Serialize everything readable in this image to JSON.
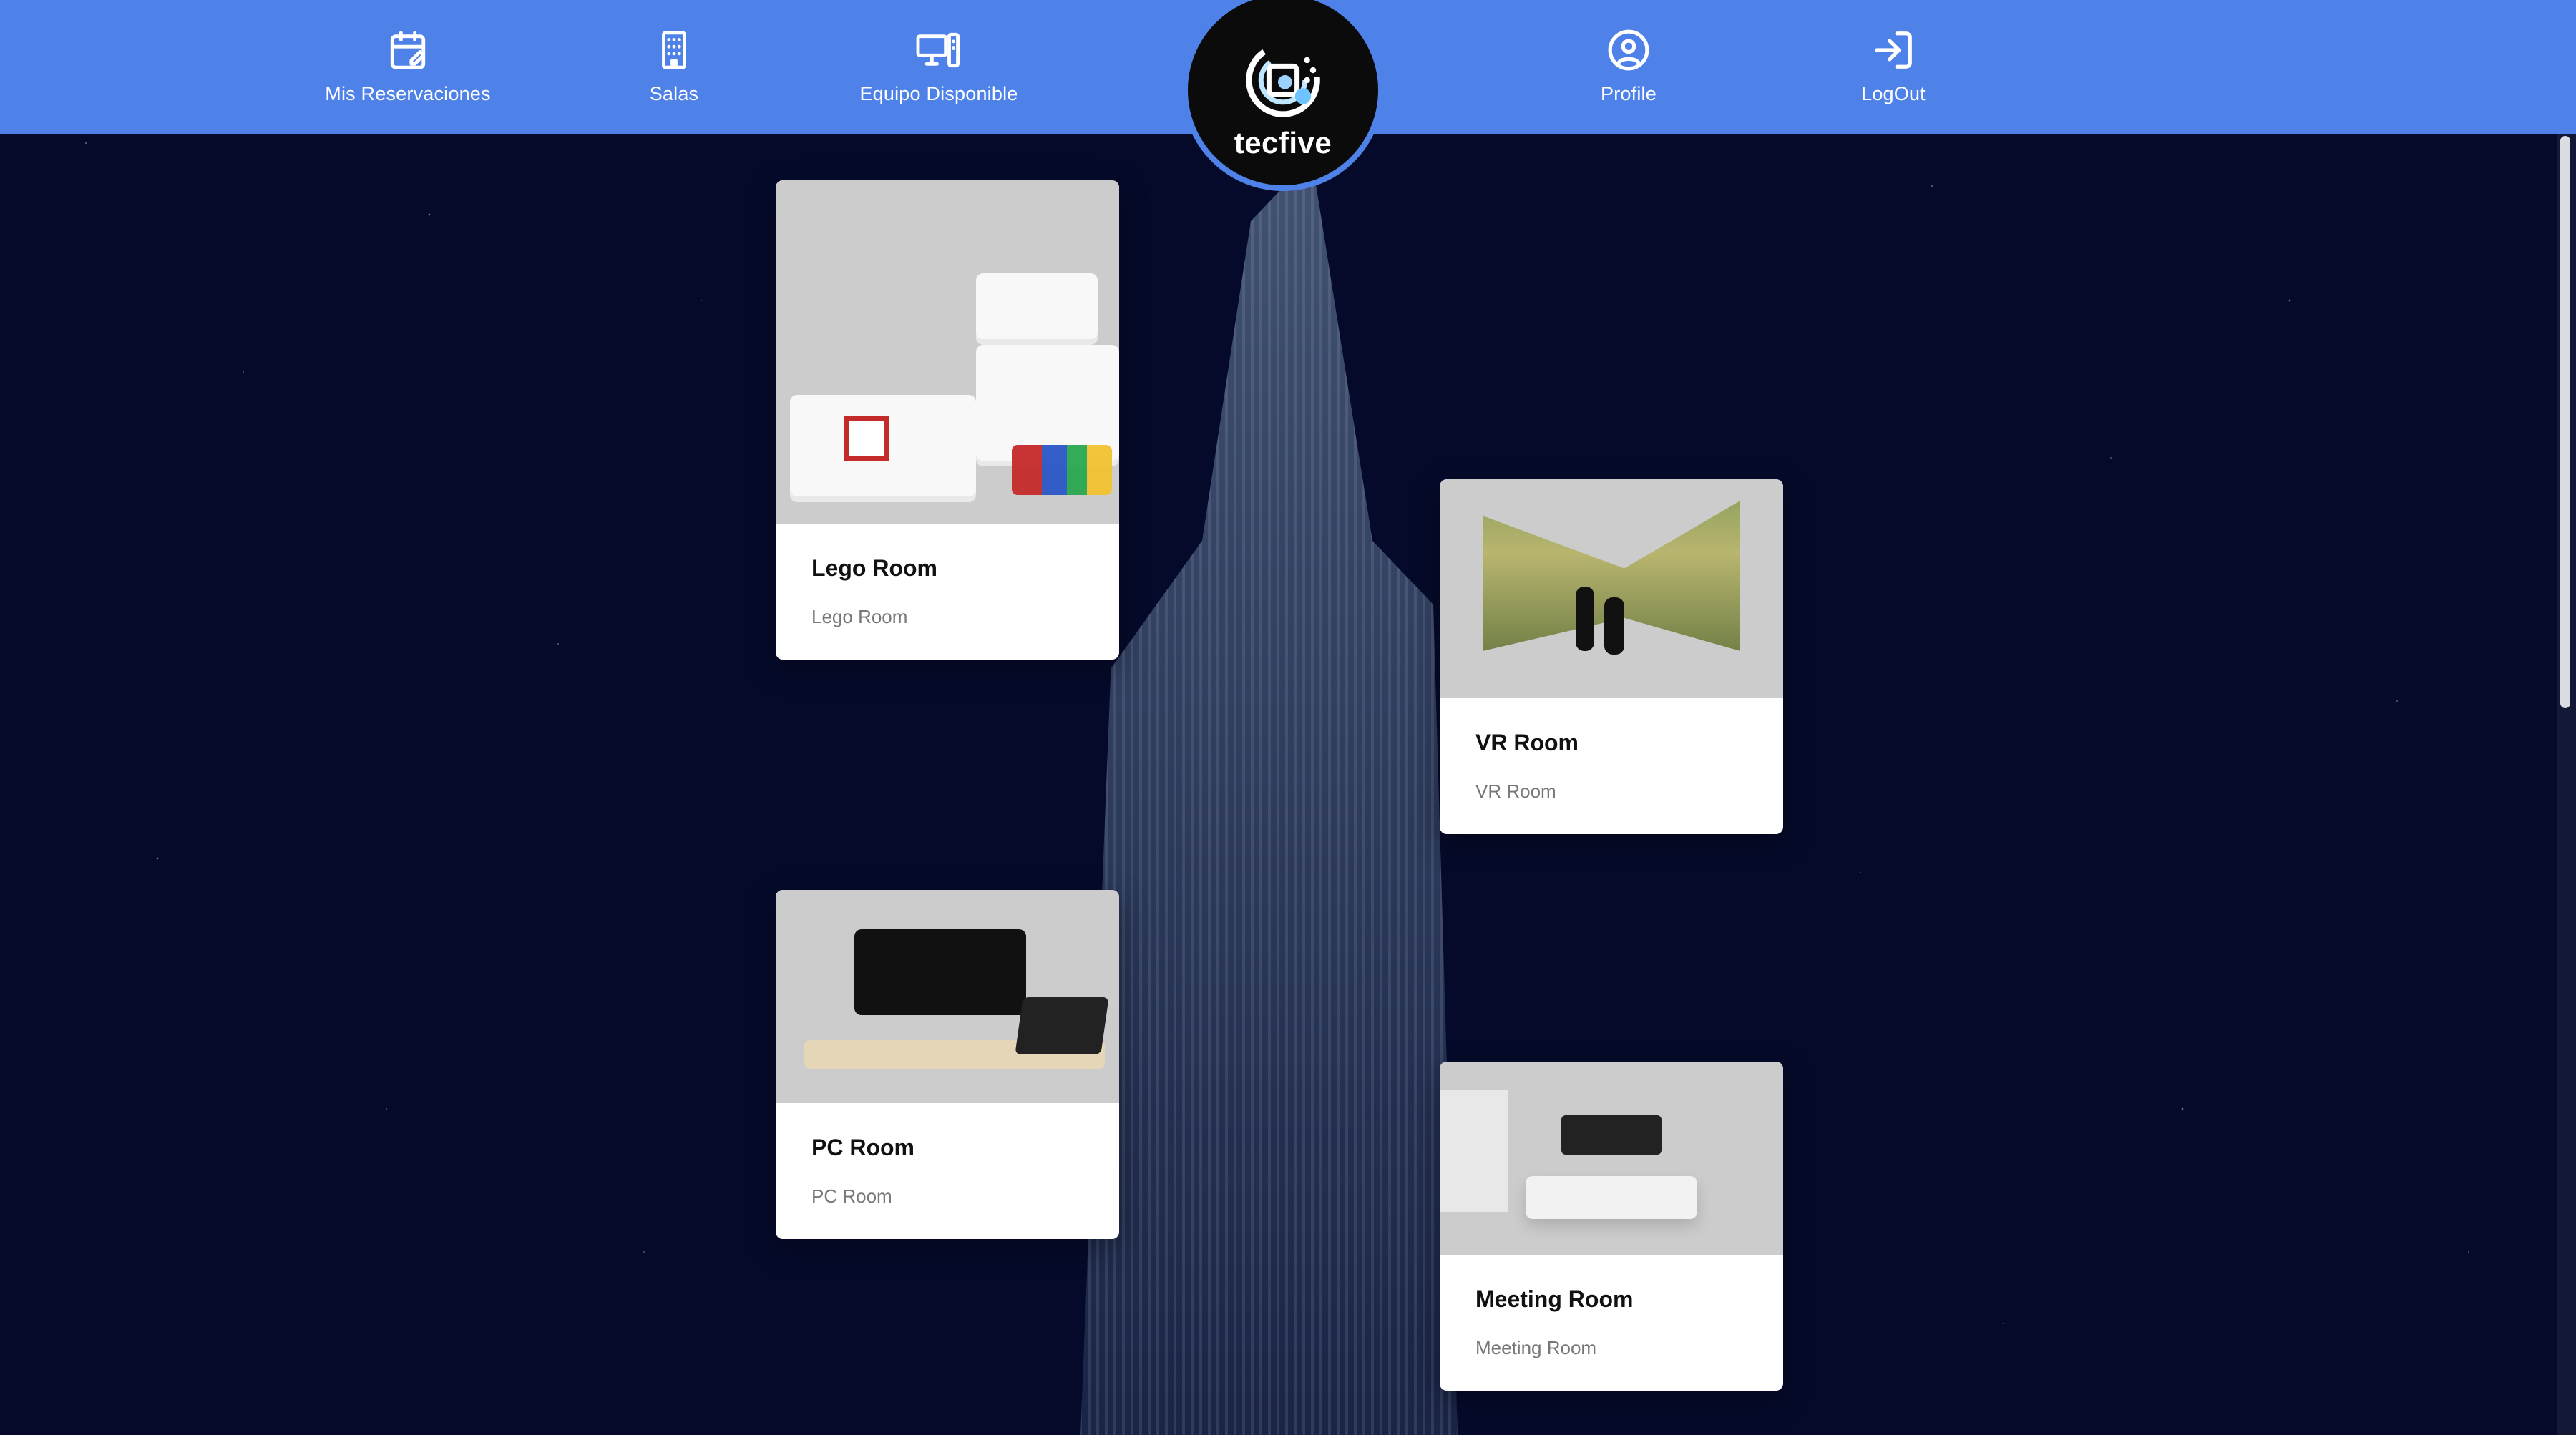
{
  "header": {
    "nav_items": [
      {
        "label": "Mis Reservaciones",
        "icon": "calendar-edit-icon"
      },
      {
        "label": "Salas",
        "icon": "building-icon"
      },
      {
        "label": "Equipo Disponible",
        "icon": "computer-equipment-icon"
      },
      {
        "label": "Profile",
        "icon": "user-circle-icon"
      },
      {
        "label": "LogOut",
        "icon": "logout-icon"
      }
    ],
    "logo_text": "tecfive",
    "accent_color": "#4f82e9"
  },
  "cards": [
    {
      "title": "Lego Room",
      "subtitle": "Lego Room"
    },
    {
      "title": "VR Room",
      "subtitle": "VR Room"
    },
    {
      "title": "PC Room",
      "subtitle": "PC Room"
    },
    {
      "title": "Meeting Room",
      "subtitle": "Meeting Room"
    }
  ]
}
